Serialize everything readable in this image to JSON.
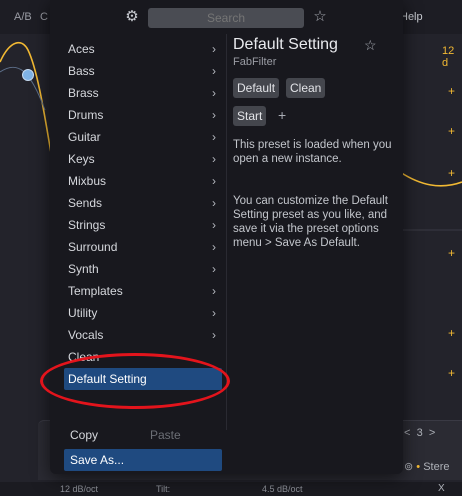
{
  "background": {
    "ab_label": "A/B",
    "c_label": "C",
    "help_label": "Help",
    "gain_readout": "12 d",
    "plus_markers": [
      "+",
      "+",
      "+",
      "+",
      "+",
      "+"
    ],
    "page_number": "3",
    "page_prev": "<",
    "page_next": ">",
    "stereo_label": "Stere",
    "footer": {
      "slope": "12 dB/oct",
      "tilt": "Tilt:",
      "tilt_value": "4.5 dB/oct"
    },
    "close_label": "X",
    "accent_color": "#f2b933"
  },
  "popup": {
    "search_placeholder": "Search",
    "categories": [
      {
        "label": "Aces",
        "chevron": "›"
      },
      {
        "label": "Bass",
        "chevron": "›"
      },
      {
        "label": "Brass",
        "chevron": "›"
      },
      {
        "label": "Drums",
        "chevron": "›"
      },
      {
        "label": "Guitar",
        "chevron": "›"
      },
      {
        "label": "Keys",
        "chevron": "›"
      },
      {
        "label": "Mixbus",
        "chevron": "›"
      },
      {
        "label": "Sends",
        "chevron": "›"
      },
      {
        "label": "Strings",
        "chevron": "›"
      },
      {
        "label": "Surround",
        "chevron": "›"
      },
      {
        "label": "Synth",
        "chevron": "›"
      },
      {
        "label": "Templates",
        "chevron": "›"
      },
      {
        "label": "Utility",
        "chevron": "›"
      },
      {
        "label": "Vocals",
        "chevron": "›"
      }
    ],
    "presets": [
      {
        "label": "Clean"
      },
      {
        "label": "Default Setting",
        "selected": true
      }
    ],
    "copy_label": "Copy",
    "paste_label": "Paste",
    "save_as_label": "Save As...",
    "selection_color": "#1f4a80"
  },
  "detail": {
    "title": "Default Setting",
    "vendor": "FabFilter",
    "tags": [
      "Default",
      "Clean",
      "Start"
    ],
    "add_tag": "+",
    "description_1": "This preset is loaded when you open a new instance.",
    "description_2": "You can customize the Default Setting preset as you like, and save it via the preset options menu > Save As Default."
  },
  "annotation_color": "#e3141c"
}
